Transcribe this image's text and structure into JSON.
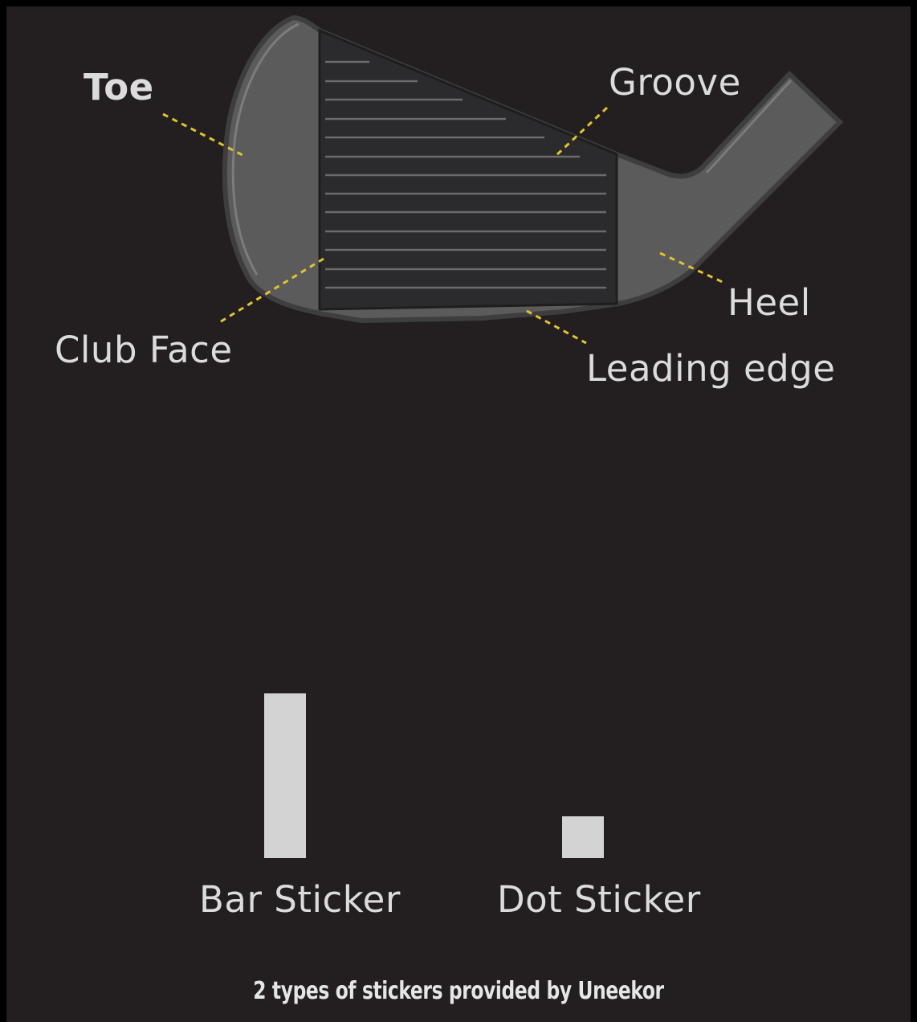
{
  "colors": {
    "background": "#231f20",
    "outer": "#000000",
    "leader": "#e3c230",
    "club_body": "#5c5c5c",
    "club_face": "#2a2a2c",
    "groove": "#6a6a6a",
    "sticker": "#d3d3d3",
    "label_text": "#dcdcdc"
  },
  "diagram": {
    "labels": {
      "toe": "Toe",
      "groove": "Groove",
      "club_face": "Club Face",
      "heel": "Heel",
      "leading_edge": "Leading edge"
    }
  },
  "stickers": {
    "bar_label": "Bar Sticker",
    "dot_label": "Dot Sticker"
  },
  "caption": "2 types of stickers provided by Uneekor"
}
